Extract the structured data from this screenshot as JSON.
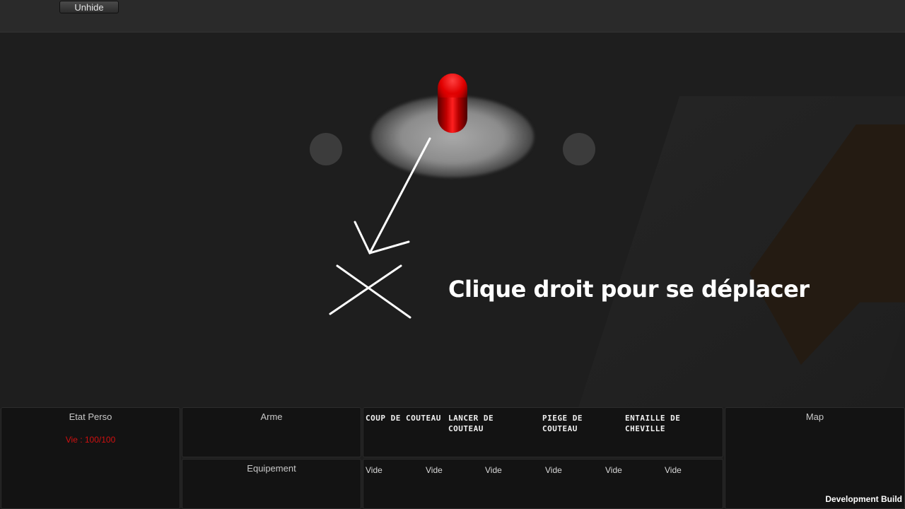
{
  "toolbar": {
    "unhide_label": "Unhide"
  },
  "scene": {
    "hint_text": "Clique droit pour se déplacer"
  },
  "hud": {
    "etat_perso": {
      "title": "Etat Perso",
      "life": "Vie : 100/100"
    },
    "arme": {
      "title": "Arme"
    },
    "equipement": {
      "title": "Equipement"
    },
    "skills": [
      "Coup de couteau",
      "Lancer de couteau",
      "Piege de couteau",
      "Entaille de cheville"
    ],
    "inventory": [
      "Vide",
      "Vide",
      "Vide",
      "Vide",
      "Vide",
      "Vide"
    ],
    "map": {
      "title": "Map"
    }
  },
  "footer": {
    "build_label": "Development Build"
  },
  "colors": {
    "life_text": "#d01010",
    "player": "#e00000",
    "ground_dark": "#1e1e1e"
  }
}
